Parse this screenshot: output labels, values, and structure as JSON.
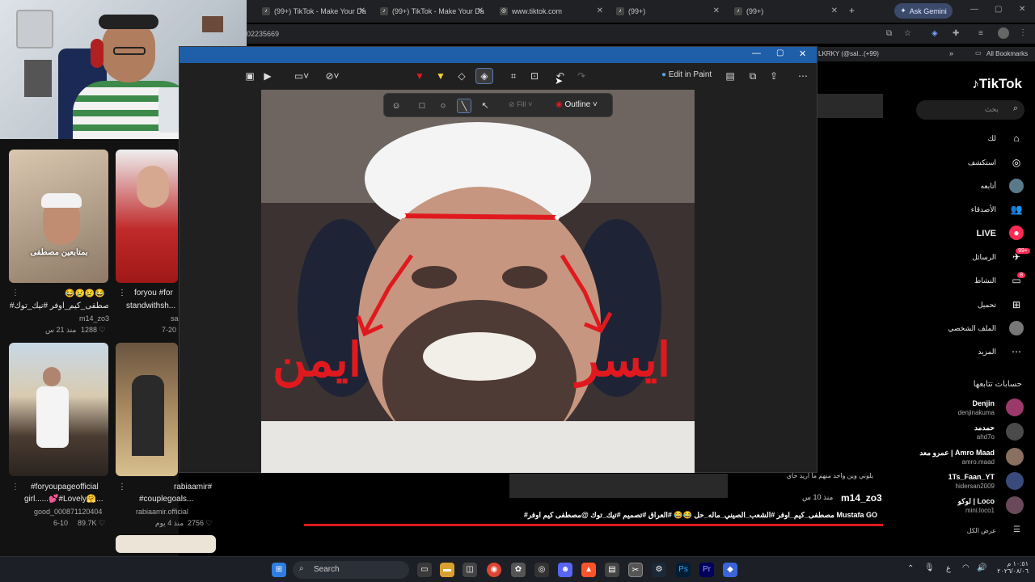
{
  "browser": {
    "tabs": [
      {
        "title": "(99+) TikTok - Make Your Da",
        "fav": "tiktok-icon"
      },
      {
        "title": "(99+) TikTok - Make Your Da",
        "fav": "tiktok-icon"
      },
      {
        "title": "www.tiktok.com",
        "fav": "globe-icon"
      },
      {
        "title": "(99+)",
        "fav": "tiktok-icon"
      },
      {
        "title": "(99+)",
        "fav": "tiktok-icon"
      }
    ],
    "new_tab": "+",
    "ask_gemini": "Ask Gemini",
    "url_fragment": "02235669",
    "bookmark_fragment": "LKRKY (@sal...(+99)",
    "all_bookmarks": "All Bookmarks"
  },
  "snipping_tool": {
    "edit_in_paint": "Edit in Paint",
    "shape_bar": {
      "fill": "Fill",
      "outline": "Outline"
    },
    "annotations": {
      "left_text": "ايمن",
      "right_text": "ايسر"
    }
  },
  "feed": {
    "cards": [
      {
        "overlay": "بمتابعين مصطفى",
        "caption": "#مصطفى_كيم_اوفر #نيك_توك...",
        "emojis": "😂😢😢😂",
        "user": "m14_zo3",
        "likes": "1288",
        "time": "منذ 21 س"
      },
      {
        "caption": "foryou #for",
        "caption2": "standwithsh...",
        "user": "sa",
        "time": "7-20"
      },
      {
        "caption": "#foryoupageofficial",
        "caption2": "girl......💕#Lovely🤗...",
        "user": "good_000871120404",
        "likes": "89.7K",
        "time": "6-10"
      },
      {
        "caption": "rabiaamir#",
        "caption2": "#couplegoals...",
        "user": "rabiaamir.official",
        "likes": "2756",
        "time": "منذ 4 يوم"
      }
    ]
  },
  "video_overlay": {
    "top_text": "يلوني وين واحد منهم ما اريد حاي",
    "user": "m14_zo3",
    "time": "منذ 10 س",
    "hashtags": "#مصطفى_كيم_اوفر #الشعب_الصيني_ماله_حل 😂😂 #العراق #تصميم #تيك_توك @مصطفى كيم اوفر Mustafa GO"
  },
  "tiktok": {
    "logo": "TikTok",
    "search_placeholder": "بحث",
    "nav": [
      {
        "label": "لك",
        "icon": "home-icon"
      },
      {
        "label": "استكشف",
        "icon": "compass-icon"
      },
      {
        "label": "أتابعه",
        "icon": "following-avatar-icon"
      },
      {
        "label": "الأصدقاء",
        "icon": "friends-icon"
      },
      {
        "label": "LIVE",
        "icon": "live-icon"
      },
      {
        "label": "الرسائل",
        "icon": "messages-icon",
        "badge": "99+"
      },
      {
        "label": "النشاط",
        "icon": "activity-icon",
        "badge": "8"
      },
      {
        "label": "تحميل",
        "icon": "upload-icon"
      },
      {
        "label": "الملف الشخصي",
        "icon": "profile-icon"
      },
      {
        "label": "المزيد",
        "icon": "more-icon"
      }
    ],
    "following_title": "حسابات تتابعها",
    "following": [
      {
        "name": "Denjin",
        "handle": "denjinakuma"
      },
      {
        "name": "حمدمد",
        "handle": "ahd7o"
      },
      {
        "name": "عمرو معد | Amro Maad",
        "handle": "amro.maad"
      },
      {
        "name": "1Ts_Faan_YT",
        "handle": "hidersan2009"
      },
      {
        "name": "لوكو | Loco",
        "handle": "mini.loco1"
      }
    ],
    "show_all": "عرض الكل"
  },
  "taskbar": {
    "search_label": "Search",
    "clock_time": "١٠:٥١ م",
    "clock_date": "٢٠٢٦/٠٨/٠٦",
    "lang": "ع"
  },
  "colors": {
    "accent_red": "#e0191f",
    "tiktok_pink": "#fe2c55",
    "titlebar_blue": "#1f5ea8"
  }
}
